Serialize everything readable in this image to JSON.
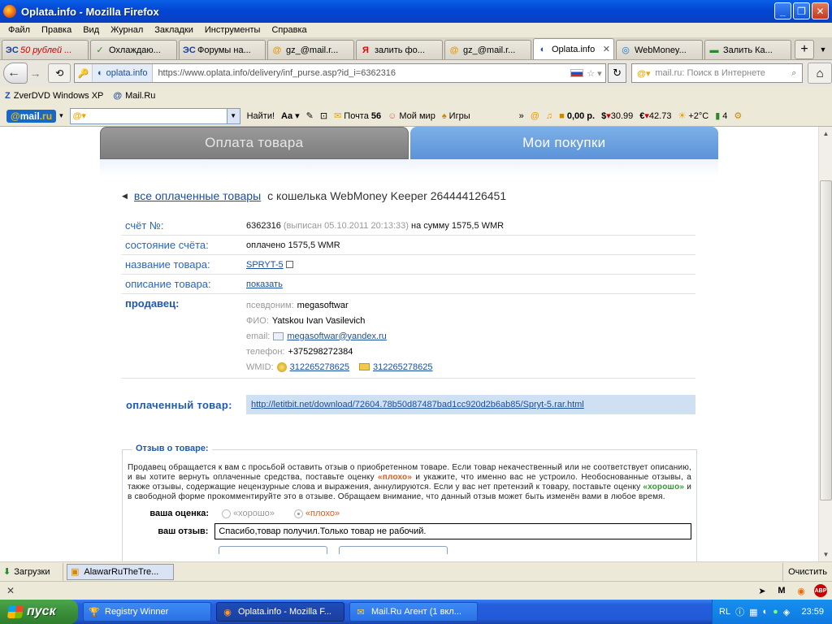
{
  "window": {
    "title": "Oplata.info - Mozilla Firefox"
  },
  "menu": [
    "Файл",
    "Правка",
    "Вид",
    "Журнал",
    "Закладки",
    "Инструменты",
    "Справка"
  ],
  "tabs": [
    {
      "label": "50 рублей ...",
      "icon": "ЭС",
      "icon_name": "bank-icon"
    },
    {
      "label": "Охлаждаю...",
      "icon": "✓",
      "icon_name": "webmoney-check-icon"
    },
    {
      "label": "Форумы на...",
      "icon": "ЭС",
      "icon_name": "forum-icon"
    },
    {
      "label": "gz_@mail.r...",
      "icon": "@",
      "icon_name": "mail-icon"
    },
    {
      "label": "залить фо...",
      "icon": "Я",
      "icon_name": "yandex-icon"
    },
    {
      "label": "gz_@mail.r...",
      "icon": "@",
      "icon_name": "mail-icon"
    },
    {
      "label": "Oplata.info",
      "icon": "◐",
      "icon_name": "oplata-icon",
      "active": true
    },
    {
      "label": "WebMoney...",
      "icon": "◎",
      "icon_name": "globe-icon"
    },
    {
      "label": "Залить Ка...",
      "icon": "▬",
      "icon_name": "page-icon"
    }
  ],
  "nav": {
    "identity": "oplata.info",
    "url": "https://www.oplata.info/delivery/inf_purse.asp?id_i=6362316",
    "search_placeholder": "mail.ru: Поиск в Интернете"
  },
  "bookmarks": [
    {
      "label": "ZverDVD Windows XP",
      "icon": "Z"
    },
    {
      "label": "Mail.Ru",
      "icon": "@"
    }
  ],
  "mailbar": {
    "logo_prefix": "@",
    "logo_text": "mail",
    "logo_suffix": ".ru",
    "find": "Найти!",
    "mail": "Почта",
    "mail_count": "56",
    "myworld": "Мой мир",
    "games": "Игры",
    "balance": "0,00 р.",
    "usd": "30.99",
    "eur": "42.73",
    "weather": "+2°C",
    "traffic": "4"
  },
  "page": {
    "tab_pay": "Оплата товара",
    "tab_purchases": "Мои покупки",
    "back_link": "все оплаченные товары",
    "back_suffix": "с кошелька WebMoney Keeper 264444126451",
    "invoice_label": "счёт №:",
    "invoice_num": "6362316",
    "invoice_issued": "(выписан 05.10.2011 20:13:33)",
    "invoice_sum": "на сумму 1575,5 WMR",
    "status_label": "состояние счёта:",
    "status_value": "оплачено 1575,5 WMR",
    "product_label": "название товара:",
    "product_value": "SPRYT-5",
    "desc_label": "описание товара:",
    "desc_value": "показать",
    "seller_label": "продавец:",
    "seller_nick_k": "псевдоним:",
    "seller_nick": "megasoftwar",
    "seller_fio_k": "ФИО:",
    "seller_fio": "Yatskou Ivan Vasilevich",
    "seller_email_k": "email:",
    "seller_email": "megasoftwar@yandex.ru",
    "seller_phone_k": "телефон:",
    "seller_phone": "+375298272384",
    "seller_wmid_k": "WMID:",
    "seller_wmid1": "312265278625",
    "seller_wmid2": "312265278625",
    "paid_label": "оплаченный товар:",
    "paid_link": "http://letitbit.net/download/72604.78b50d87487bad1cc920d2b6ab85/Spryt-5.rar.html",
    "review_legend": "Отзыв о товаре:",
    "review_text_1": "Продавец обращается к вам с просьбой оставить отзыв о приобретенном товаре. Если товар некачественный или не соответствует описанию, и вы хотите вернуть оплаченные средства, поставьте оценку ",
    "review_bad_word": "«плохо»",
    "review_text_2": " и укажите, что именно вас не устроило. Необоснованные отзывы, а также отзывы, содержащие нецензурные слова и выражения, аннулируются. Если у вас нет претензий к товару, поставьте оценку ",
    "review_good_word": "«хорошо»",
    "review_text_3": " и в свободной форме прокомментируйте это в отзыве. Обращаем внимание, что данный отзыв может быть изменён вами в любое время.",
    "rating_label": "ваша оценка:",
    "rating_good": "«хорошо»",
    "rating_bad": "«плохо»",
    "review_label": "ваш отзыв:",
    "review_value": "Спасибо,товар получил.Только товар не рабочий."
  },
  "downloads": {
    "label": "Загрузки",
    "item": "AlawarRuTheTre...",
    "clear": "Очистить"
  },
  "taskbar": {
    "start": "пуск",
    "items": [
      {
        "label": "Registry Winner",
        "icon": "🏆"
      },
      {
        "label": "Oplata.info - Mozilla F...",
        "icon": "◉",
        "active": true
      },
      {
        "label": "Mail.Ru Агент (1 вкл...",
        "icon": "✉"
      }
    ],
    "lang": "RL",
    "clock": "23:59"
  }
}
